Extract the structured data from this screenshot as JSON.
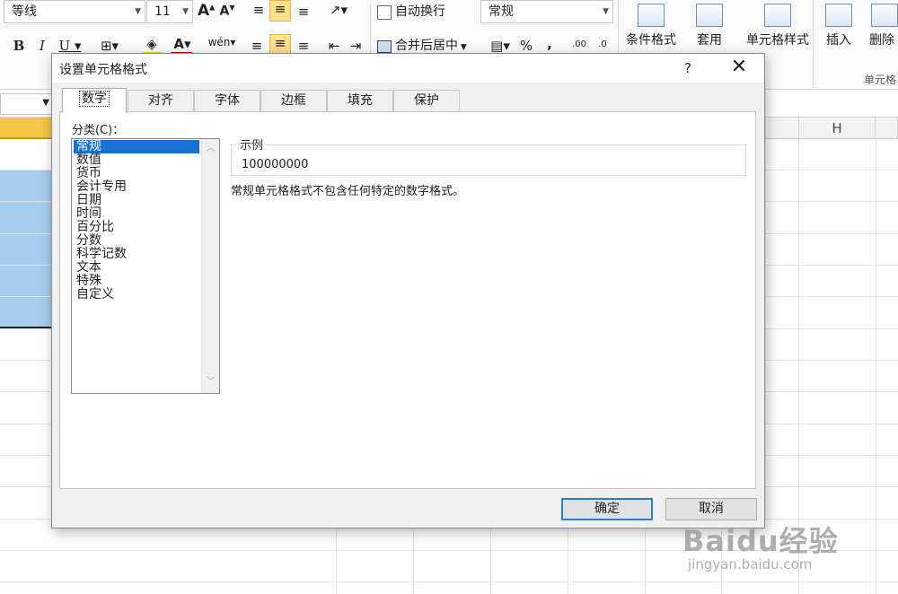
{
  "ribbon": {
    "font_name": "等线",
    "font_size": "11",
    "grow_font_label": "A",
    "shrink_font_label": "A",
    "bold_label": "B",
    "italic_label": "I",
    "underline_label": "U",
    "wrap_text_label": "自动换行",
    "merge_center_label": "合并后居中",
    "number_format": "常规",
    "percent_label": "%",
    "comma_label": ",",
    "conditional_format_label": "条件格式",
    "table_format_label": "套用",
    "cell_styles_label": "单元格样式",
    "insert_label": "插入",
    "delete_label": "删除",
    "cells_group_label": "单元格"
  },
  "sheet": {
    "visible_column_header": "H",
    "selected_fill": "#a7cdee",
    "header_highlight": "#f5c744"
  },
  "dialog": {
    "title": "设置单元格格式",
    "help_label": "?",
    "close_label": "✕",
    "tabs": [
      {
        "label": "数字",
        "active": true
      },
      {
        "label": "对齐",
        "active": false
      },
      {
        "label": "字体",
        "active": false
      },
      {
        "label": "边框",
        "active": false
      },
      {
        "label": "填充",
        "active": false
      },
      {
        "label": "保护",
        "active": false
      }
    ],
    "category_label": "分类(C)：",
    "categories": [
      "常规",
      "数值",
      "货币",
      "会计专用",
      "日期",
      "时间",
      "百分比",
      "分数",
      "科学记数",
      "文本",
      "特殊",
      "自定义"
    ],
    "selected_category": "常规",
    "sample_legend": "示例",
    "sample_value": "100000000",
    "description": "常规单元格格式不包含任何特定的数字格式。",
    "ok_label": "确定",
    "cancel_label": "取消"
  },
  "watermark": {
    "main": "Baidu经验",
    "sub": "jingyan.baidu.com"
  }
}
